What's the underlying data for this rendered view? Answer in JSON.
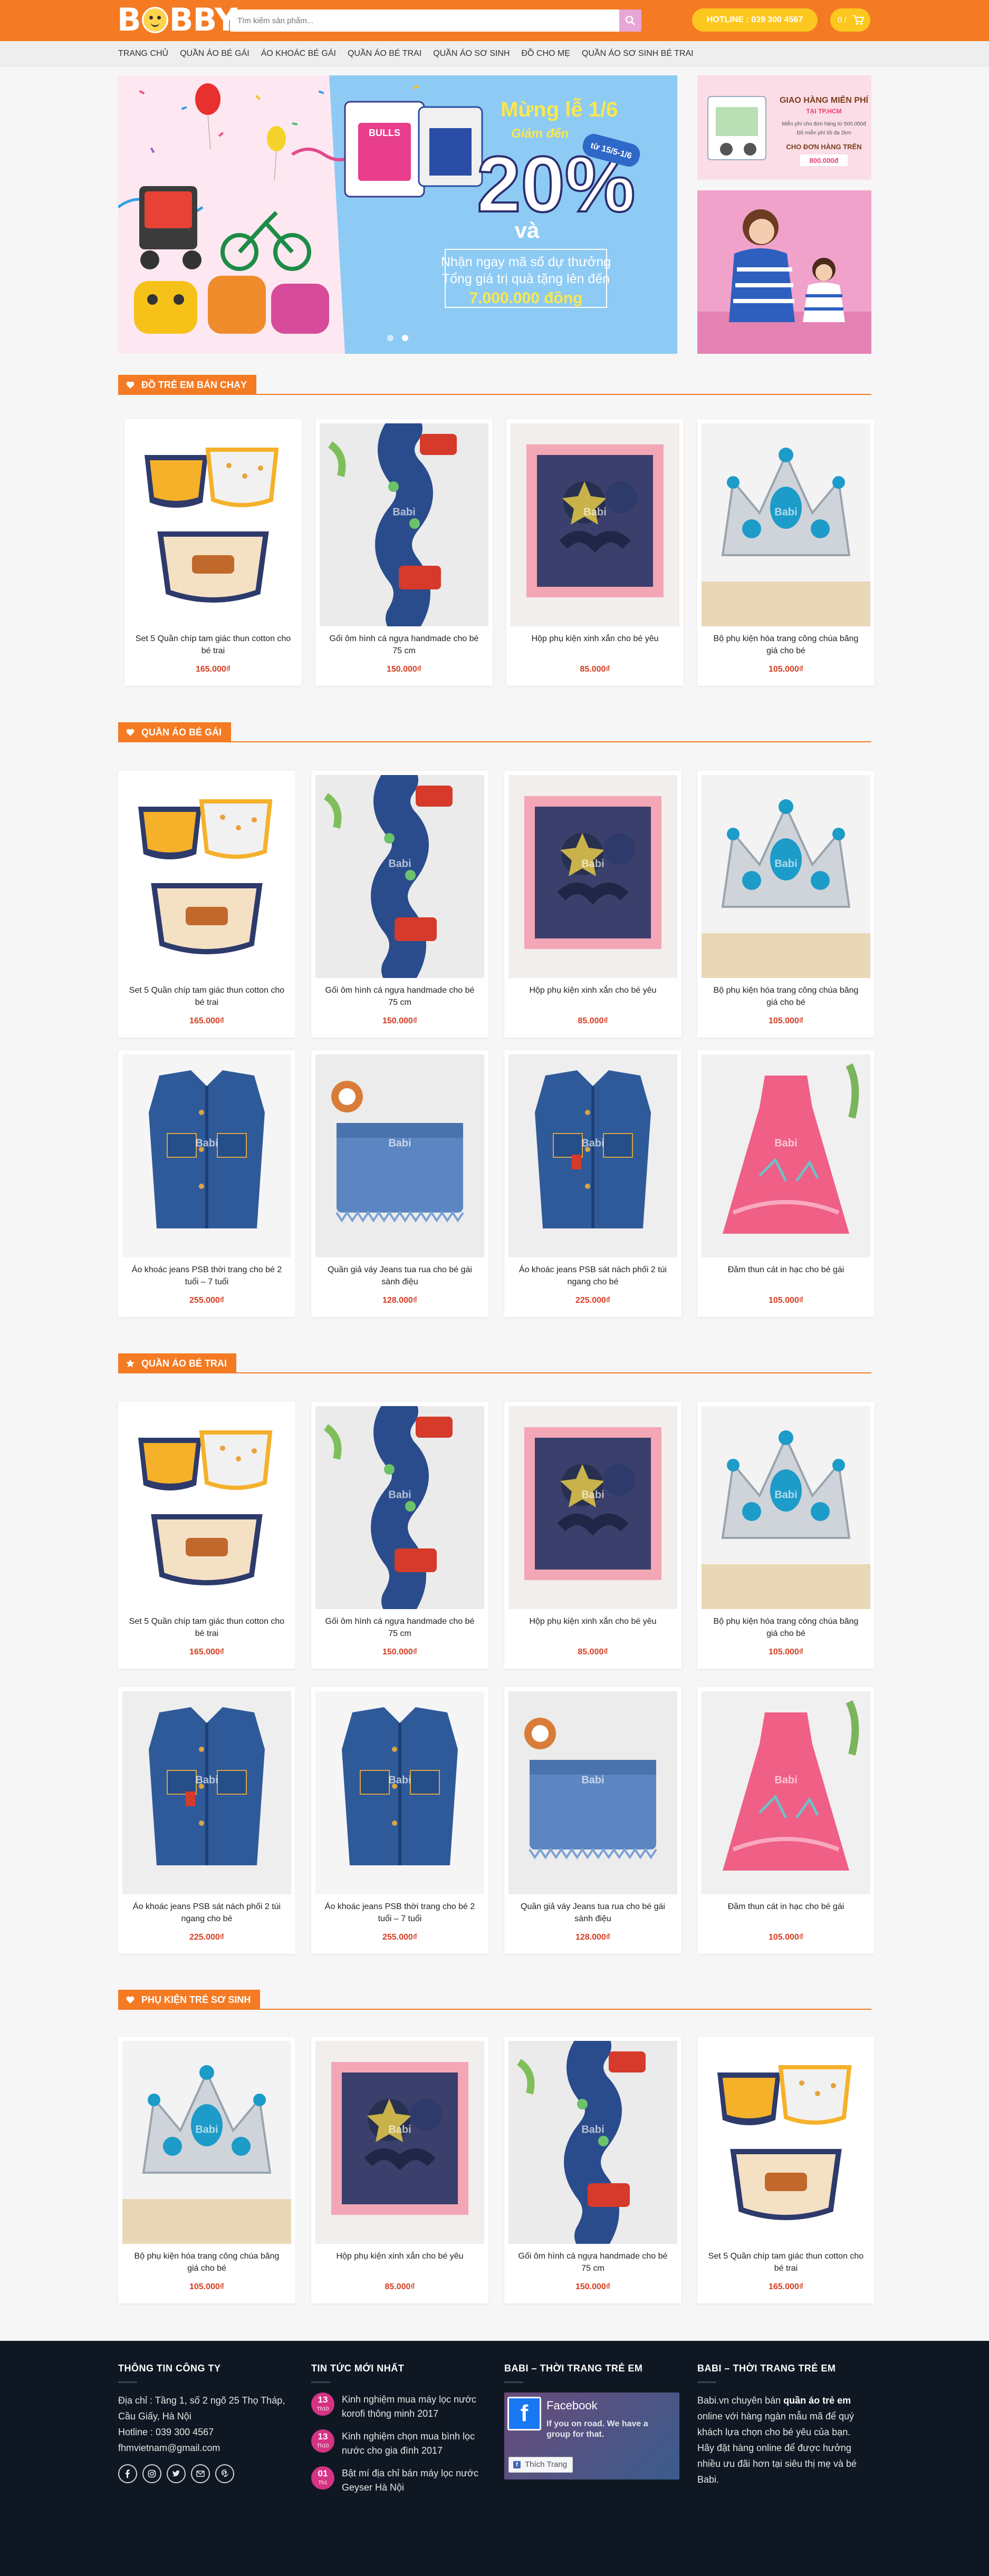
{
  "header": {
    "logo_text": [
      "B",
      "BBY"
    ],
    "search_placeholder": "Tìm kiếm sản phẩm...",
    "hotline": "HOTLINE : 039 300 4567",
    "cart_count": "0 /",
    "brand_color": "#f47a23",
    "accent_color": "#fcc81f"
  },
  "nav": {
    "items": [
      "Trang chủ",
      "Quần áo bé gái",
      "Áo khoác bé gái",
      "Quần áo bé trai",
      "Quần áo sơ sinh",
      "Đồ cho mẹ",
      "Quần áo sơ sinh bé trai"
    ]
  },
  "banner": {
    "headline": "Mừng lễ 1/6",
    "subhead": "Giảm đến",
    "percent": "20%",
    "date_badge": "từ 15/5-1/6",
    "and": "và",
    "line1": "Nhận ngay mã số dự thưởng",
    "line2": "Tổng giá trị quà tặng lên đến",
    "amount": "7.000.000 đồng",
    "jersey_text": "BULLS",
    "side_title": "GIAO HÀNG MIỄN PHÍ",
    "side_city": "TẠI TP.HCM",
    "side_note1": "Miễn phí cho đơn hàng từ 500.000đ",
    "side_note2": "Đồ miễn phí tối đa 2km",
    "side_label": "CHO ĐƠN HÀNG TRÊN",
    "side_amount": "800.000đ"
  },
  "sections": [
    {
      "title": "Đồ trẻ em bán chạy",
      "icon": "heart-icon",
      "products": [
        {
          "name": "Set 5 Quần chíp tam giác thun cotton cho bé trai",
          "price": "165.000₫",
          "image": "briefs"
        },
        {
          "name": "Gối ôm hình cá ngựa handmade cho bé 75 cm",
          "price": "150.000₫",
          "image": "seahorse"
        },
        {
          "name": "Hộp phụ kiện xinh xắn cho bé yêu",
          "price": "85.000₫",
          "image": "giftbox"
        },
        {
          "name": "Bộ phụ kiện hóa trang công chúa băng giá cho bé",
          "price": "105.000₫",
          "image": "crown"
        }
      ]
    },
    {
      "title": "Quần áo bé gái",
      "icon": "heart-icon",
      "products": [
        {
          "name": "Set 5 Quần chíp tam giác thun cotton cho bé trai",
          "price": "165.000₫",
          "image": "briefs"
        },
        {
          "name": "Gối ôm hình cá ngựa handmade cho bé 75 cm",
          "price": "150.000₫",
          "image": "seahorse"
        },
        {
          "name": "Hộp phụ kiện xinh xắn cho bé yêu",
          "price": "85.000₫",
          "image": "giftbox"
        },
        {
          "name": "Bộ phụ kiện hóa trang công chúa băng giá cho bé",
          "price": "105.000₫",
          "image": "crown"
        },
        {
          "name": "Áo khoác jeans PSB thời trang cho bé 2 tuổi – 7 tuổi",
          "price": "255.000₫",
          "image": "vest"
        },
        {
          "name": "Quần giả váy Jeans tua rua cho bé gái sành điệu",
          "price": "128.000₫",
          "image": "shorts"
        },
        {
          "name": "Áo khoác jeans PSB sát nách phối 2 túi ngang cho bé",
          "price": "225.000₫",
          "image": "vest2"
        },
        {
          "name": "Đầm thun cát in hạc cho bé gái",
          "price": "105.000₫",
          "image": "dress"
        }
      ]
    },
    {
      "title": "Quần áo bé trai",
      "icon": "star-icon",
      "products": [
        {
          "name": "Set 5 Quần chíp tam giác thun cotton cho bé trai",
          "price": "165.000₫",
          "image": "briefs"
        },
        {
          "name": "Gối ôm hình cá ngựa handmade cho bé 75 cm",
          "price": "150.000₫",
          "image": "seahorse"
        },
        {
          "name": "Hộp phụ kiện xinh xắn cho bé yêu",
          "price": "85.000₫",
          "image": "giftbox"
        },
        {
          "name": "Bộ phụ kiện hóa trang công chúa băng giá cho bé",
          "price": "105.000₫",
          "image": "crown"
        },
        {
          "name": "Áo khoác jeans PSB sát nách phối 2 túi ngang cho bé",
          "price": "225.000₫",
          "image": "vest2"
        },
        {
          "name": "Áo khoác jeans PSB thời trang cho bé 2 tuổi – 7 tuổi",
          "price": "255.000₫",
          "image": "vest"
        },
        {
          "name": "Quần giả váy Jeans tua rua cho bé gái sành điệu",
          "price": "128.000₫",
          "image": "shorts"
        },
        {
          "name": "Đầm thun cát in hạc cho bé gái",
          "price": "105.000₫",
          "image": "dress"
        }
      ]
    },
    {
      "title": "Phụ kiện trẻ sơ sinh",
      "icon": "heart-icon",
      "products": [
        {
          "name": "Bộ phụ kiện hóa trang công chúa băng giá cho bé",
          "price": "105.000₫",
          "image": "crown"
        },
        {
          "name": "Hộp phụ kiện xinh xắn cho bé yêu",
          "price": "85.000₫",
          "image": "giftbox"
        },
        {
          "name": "Gối ôm hình cá ngựa handmade cho bé 75 cm",
          "price": "150.000₫",
          "image": "seahorse"
        },
        {
          "name": "Set 5 Quần chíp tam giác thun cotton cho bé trai",
          "price": "165.000₫",
          "image": "briefs"
        }
      ]
    }
  ],
  "watermark": "Babi",
  "footer": {
    "col1": {
      "title": "Thông tin công ty",
      "address": "Địa chỉ : Tầng 1, số 2 ngõ 25 Thọ Tháp, Cầu Giấy, Hà Nội",
      "hotline": "Hotline : 039 300 4567",
      "email": "fhmvietnam@gmail.com"
    },
    "col2": {
      "title": "Tin tức mới nhất",
      "news": [
        {
          "day": "13",
          "month": "Th10",
          "title": "Kinh nghiệm mua máy lọc nước korofi thông minh 2017"
        },
        {
          "day": "13",
          "month": "Th10",
          "title": "Kinh nghiệm chọn mua bình lọc nước cho gia đình 2017"
        },
        {
          "day": "01",
          "month": "Th1",
          "title": "Bật mí địa chỉ bán máy lọc nước Geyser Hà Nội"
        }
      ]
    },
    "col3": {
      "title": "Babi – Thời trang trẻ em",
      "fb_name": "Facebook",
      "fb_button": "Thích Trang",
      "fb_cover_text": "If you on road. We have a group for that."
    },
    "col4": {
      "title": "Babi – Thời trang trẻ em",
      "text_pre": "Babi.vn chuyên bán ",
      "text_bold": "quần áo trẻ em",
      "text_post": " online với hàng ngàn mẫu mã để quý khách lựa chọn cho bé yêu của bạn.",
      "text2": "Hãy đặt hàng online để được hưởng nhiều ưu đãi hơn tại siêu thị mẹ và bé Babi."
    }
  }
}
